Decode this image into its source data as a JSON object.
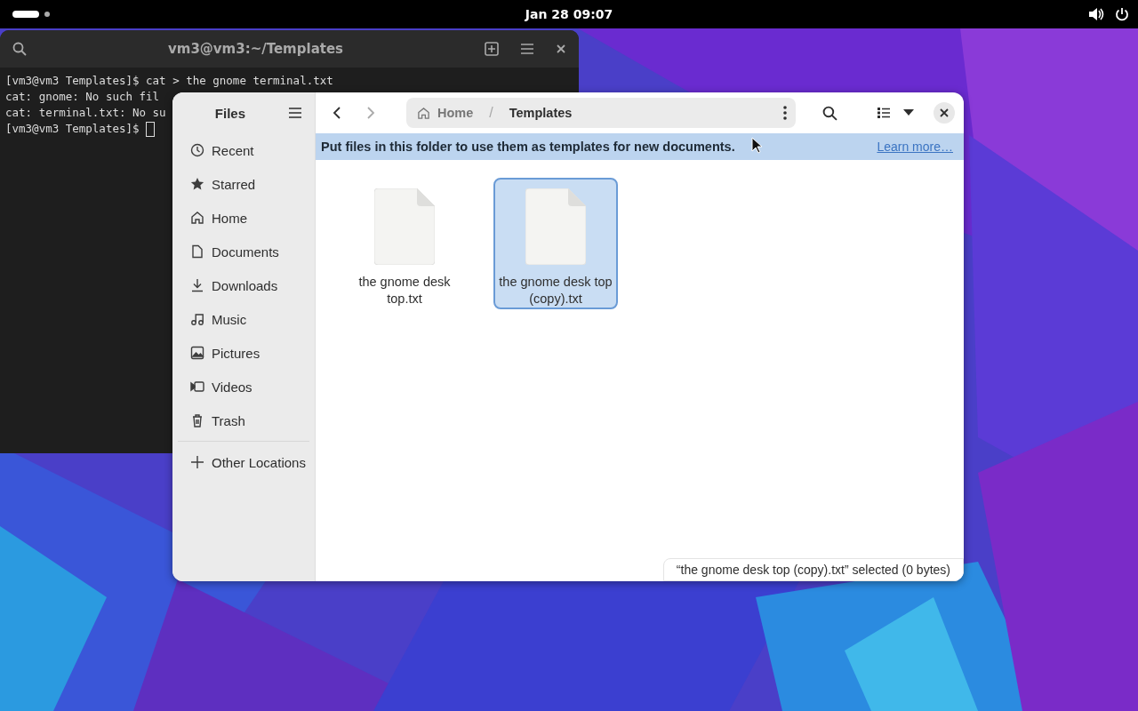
{
  "top_bar": {
    "clock": "Jan 28  09:07"
  },
  "terminal": {
    "title": "vm3@vm3:~/Templates",
    "lines": [
      "[vm3@vm3 Templates]$ cat > the gnome terminal.txt",
      "cat: gnome: No such fil",
      "cat: terminal.txt: No su",
      "[vm3@vm3 Templates]$ "
    ]
  },
  "files": {
    "title": "Files",
    "sidebar": [
      {
        "kind": "recent",
        "label": "Recent",
        "selected": false
      },
      {
        "kind": "star",
        "label": "Starred",
        "selected": false
      },
      {
        "kind": "home",
        "label": "Home",
        "selected": false
      },
      {
        "kind": "doc",
        "label": "Documents",
        "selected": false
      },
      {
        "kind": "download",
        "label": "Downloads",
        "selected": false
      },
      {
        "kind": "music",
        "label": "Music",
        "selected": false
      },
      {
        "kind": "picture",
        "label": "Pictures",
        "selected": false
      },
      {
        "kind": "video",
        "label": "Videos",
        "selected": false
      },
      {
        "kind": "trash",
        "label": "Trash",
        "selected": false
      },
      {
        "kind": "plus",
        "label": "Other Locations",
        "selected": false
      }
    ],
    "path": [
      "Home",
      "Templates"
    ],
    "path_separator": "/",
    "banner": {
      "text": "Put files in this folder to use them as templates for new documents.",
      "link": "Learn more…"
    },
    "items": [
      {
        "name": "the gnome desk top.txt",
        "selected": false
      },
      {
        "name": "the gnome desk top (copy).txt",
        "selected": true
      }
    ],
    "status": "“the gnome desk top (copy).txt” selected  (0 bytes)"
  }
}
